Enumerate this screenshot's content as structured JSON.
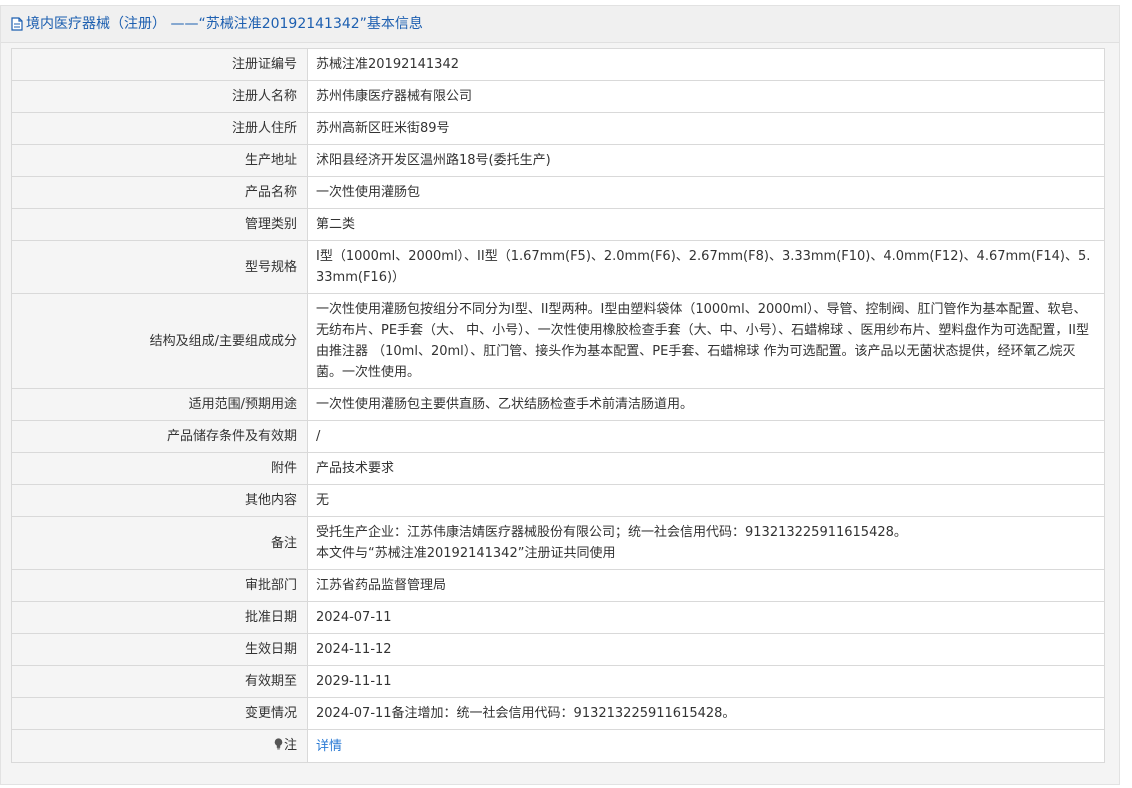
{
  "header": {
    "title": "境内医疗器械（注册） ——“苏械注准20192141342”基本信息"
  },
  "rows": [
    {
      "label": "注册证编号",
      "value": "苏械注准20192141342"
    },
    {
      "label": "注册人名称",
      "value": "苏州伟康医疗器械有限公司"
    },
    {
      "label": "注册人住所",
      "value": "苏州高新区旺米街89号"
    },
    {
      "label": "生产地址",
      "value": "沭阳县经济开发区温州路18号(委托生产)"
    },
    {
      "label": "产品名称",
      "value": "一次性使用灌肠包"
    },
    {
      "label": "管理类别",
      "value": "第二类"
    },
    {
      "label": "型号规格",
      "value": "I型（1000ml、2000ml）、II型（1.67mm(F5)、2.0mm(F6)、2.67mm(F8)、3.33mm(F10)、4.0mm(F12)、4.67mm(F14)、5.33mm(F16)）"
    },
    {
      "label": "结构及组成/主要组成成分",
      "value": "一次性使用灌肠包按组分不同分为I型、II型两种。I型由塑料袋体（1000ml、2000ml）、导管、控制阀、肛门管作为基本配置、软皂、无纺布片、PE手套（大、 中、小号）、一次性使用橡胶检查手套（大、中、小号）、石蜡棉球 、医用纱布片、塑料盘作为可选配置，II型由推注器 （10ml、20ml）、肛门管、接头作为基本配置、PE手套、石蜡棉球 作为可选配置。该产品以无菌状态提供，经环氧乙烷灭菌。一次性使用。"
    },
    {
      "label": "适用范围/预期用途",
      "value": "一次性使用灌肠包主要供直肠、乙状结肠检查手术前清洁肠道用。"
    },
    {
      "label": "产品储存条件及有效期",
      "value": "/"
    },
    {
      "label": "附件",
      "value": "产品技术要求"
    },
    {
      "label": "其他内容",
      "value": "无"
    },
    {
      "label": "备注",
      "line1": "受托生产企业：江苏伟康洁婧医疗器械股份有限公司；统一社会信用代码：913213225911615428。",
      "line2": "本文件与“苏械注准20192141342”注册证共同使用"
    },
    {
      "label": "审批部门",
      "value": "江苏省药品监督管理局"
    },
    {
      "label": "批准日期",
      "value": "2024-07-11"
    },
    {
      "label": "生效日期",
      "value": "2024-11-12"
    },
    {
      "label": "有效期至",
      "value": "2029-11-11"
    },
    {
      "label": "变更情况",
      "value": "2024-07-11备注增加：统一社会信用代码：913213225911615428。"
    }
  ],
  "note_row": {
    "label": "注",
    "link_text": "详情",
    "icon": "lightbulb-icon"
  },
  "colors": {
    "header_text": "#1d5fb0",
    "link": "#2a7ad4",
    "label_bg": "#f5f5f5",
    "border": "#d9d9d9"
  }
}
